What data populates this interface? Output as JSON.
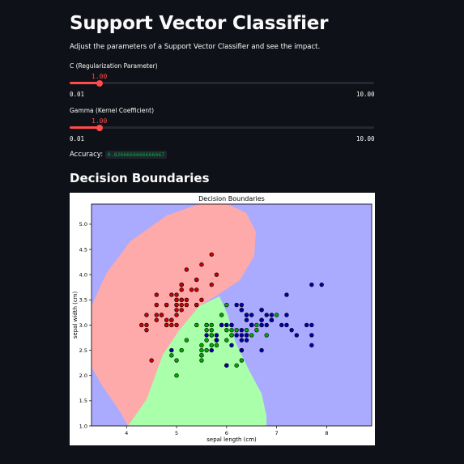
{
  "app": {
    "title": "Support Vector Classifier",
    "subtitle": "Adjust the parameters of a Support Vector Classifier and see the impact."
  },
  "sliders": [
    {
      "label": "C (Regularization Parameter)",
      "value": "1.00",
      "min": "0.01",
      "max": "10.00",
      "fraction": 0.099
    },
    {
      "label": "Gamma (Kernel Coefficient)",
      "value": "1.00",
      "min": "0.01",
      "max": "10.00",
      "fraction": 0.099
    }
  ],
  "accuracy": {
    "label": "Accuracy:",
    "value": "0.8266666666666667"
  },
  "section_heading": "Decision Boundaries",
  "colors": {
    "accent": "#ff4b4b",
    "region_setosa": "#ffaaaa",
    "region_versicolor": "#aaffaa",
    "region_virginica": "#aaaaff",
    "point_setosa": "#cc0000",
    "point_versicolor": "#00aa00",
    "point_virginica": "#0000aa"
  },
  "chart_data": {
    "type": "scatter",
    "title": "Decision Boundaries",
    "xlabel": "sepal length (cm)",
    "ylabel": "sepal width (cm)",
    "xlim": [
      3.3,
      8.9
    ],
    "ylim": [
      1.0,
      5.4
    ],
    "xticks": [
      "4",
      "5",
      "6",
      "7",
      "8"
    ],
    "yticks": [
      "1.0",
      "1.5",
      "2.0",
      "2.5",
      "3.0",
      "3.5",
      "4.0",
      "4.5",
      "5.0"
    ],
    "grid": false,
    "series": [
      {
        "class": 0,
        "points": [
          [
            5.1,
            3.5
          ],
          [
            4.9,
            3.0
          ],
          [
            4.7,
            3.2
          ],
          [
            4.6,
            3.1
          ],
          [
            5.0,
            3.6
          ],
          [
            5.4,
            3.9
          ],
          [
            4.6,
            3.4
          ],
          [
            5.0,
            3.4
          ],
          [
            4.4,
            2.9
          ],
          [
            4.9,
            3.1
          ],
          [
            5.4,
            3.7
          ],
          [
            4.8,
            3.4
          ],
          [
            4.8,
            3.0
          ],
          [
            4.3,
            3.0
          ],
          [
            5.8,
            4.0
          ],
          [
            5.7,
            4.4
          ],
          [
            5.4,
            3.9
          ],
          [
            5.1,
            3.5
          ],
          [
            5.7,
            3.8
          ],
          [
            5.1,
            3.8
          ],
          [
            5.4,
            3.4
          ],
          [
            5.1,
            3.7
          ],
          [
            4.6,
            3.6
          ],
          [
            5.1,
            3.3
          ],
          [
            4.8,
            3.4
          ],
          [
            5.0,
            3.0
          ],
          [
            5.0,
            3.4
          ],
          [
            5.2,
            3.5
          ],
          [
            5.2,
            3.4
          ],
          [
            4.7,
            3.2
          ],
          [
            4.8,
            3.1
          ],
          [
            5.4,
            3.4
          ],
          [
            5.2,
            4.1
          ],
          [
            5.5,
            4.2
          ],
          [
            4.9,
            3.1
          ],
          [
            5.0,
            3.2
          ],
          [
            5.5,
            3.5
          ],
          [
            4.9,
            3.6
          ],
          [
            4.4,
            3.0
          ],
          [
            5.1,
            3.4
          ],
          [
            5.0,
            3.5
          ],
          [
            4.5,
            2.3
          ],
          [
            4.4,
            3.2
          ],
          [
            5.0,
            3.5
          ],
          [
            5.1,
            3.8
          ],
          [
            4.8,
            3.0
          ],
          [
            5.1,
            3.8
          ],
          [
            4.6,
            3.2
          ],
          [
            5.3,
            3.7
          ],
          [
            5.0,
            3.3
          ]
        ]
      },
      {
        "class": 1,
        "points": [
          [
            7.0,
            3.2
          ],
          [
            6.4,
            3.2
          ],
          [
            6.9,
            3.1
          ],
          [
            5.5,
            2.3
          ],
          [
            6.5,
            2.8
          ],
          [
            5.7,
            2.8
          ],
          [
            6.3,
            3.3
          ],
          [
            4.9,
            2.4
          ],
          [
            6.6,
            2.9
          ],
          [
            5.2,
            2.7
          ],
          [
            5.0,
            2.0
          ],
          [
            5.9,
            3.0
          ],
          [
            6.0,
            2.2
          ],
          [
            6.1,
            2.9
          ],
          [
            5.6,
            2.9
          ],
          [
            6.7,
            3.1
          ],
          [
            5.6,
            3.0
          ],
          [
            5.8,
            2.7
          ],
          [
            6.2,
            2.2
          ],
          [
            5.6,
            2.5
          ],
          [
            5.9,
            3.2
          ],
          [
            6.1,
            2.8
          ],
          [
            6.3,
            2.5
          ],
          [
            6.1,
            2.8
          ],
          [
            6.4,
            2.9
          ],
          [
            6.6,
            3.0
          ],
          [
            6.8,
            2.8
          ],
          [
            6.7,
            3.0
          ],
          [
            6.0,
            2.9
          ],
          [
            5.7,
            2.6
          ],
          [
            5.5,
            2.4
          ],
          [
            5.5,
            2.4
          ],
          [
            5.8,
            2.7
          ],
          [
            6.0,
            2.7
          ],
          [
            5.4,
            3.0
          ],
          [
            6.0,
            3.4
          ],
          [
            6.7,
            3.1
          ],
          [
            6.3,
            2.3
          ],
          [
            5.6,
            3.0
          ],
          [
            5.5,
            2.5
          ],
          [
            5.5,
            2.6
          ],
          [
            6.1,
            3.0
          ],
          [
            5.8,
            2.6
          ],
          [
            5.0,
            2.3
          ],
          [
            5.6,
            2.7
          ],
          [
            5.7,
            3.0
          ],
          [
            5.7,
            2.9
          ],
          [
            6.2,
            2.9
          ],
          [
            5.1,
            2.5
          ],
          [
            5.7,
            2.8
          ]
        ]
      },
      {
        "class": 2,
        "points": [
          [
            6.3,
            3.3
          ],
          [
            5.8,
            2.7
          ],
          [
            7.1,
            3.0
          ],
          [
            6.3,
            2.9
          ],
          [
            6.5,
            3.0
          ],
          [
            7.6,
            3.0
          ],
          [
            4.9,
            2.5
          ],
          [
            7.3,
            2.9
          ],
          [
            6.7,
            2.5
          ],
          [
            7.2,
            3.6
          ],
          [
            6.5,
            3.2
          ],
          [
            6.4,
            2.7
          ],
          [
            6.8,
            3.0
          ],
          [
            5.7,
            2.5
          ],
          [
            5.8,
            2.8
          ],
          [
            6.4,
            3.2
          ],
          [
            6.5,
            3.0
          ],
          [
            7.7,
            3.8
          ],
          [
            7.7,
            2.6
          ],
          [
            6.0,
            2.2
          ],
          [
            6.9,
            3.2
          ],
          [
            5.6,
            2.8
          ],
          [
            7.7,
            2.8
          ],
          [
            6.3,
            2.7
          ],
          [
            6.7,
            3.3
          ],
          [
            7.2,
            3.2
          ],
          [
            6.2,
            2.8
          ],
          [
            6.1,
            3.0
          ],
          [
            6.4,
            2.8
          ],
          [
            7.2,
            3.0
          ],
          [
            7.4,
            2.8
          ],
          [
            7.9,
            3.8
          ],
          [
            6.4,
            2.8
          ],
          [
            6.3,
            2.8
          ],
          [
            6.1,
            2.6
          ],
          [
            7.7,
            3.0
          ],
          [
            6.3,
            3.4
          ],
          [
            6.4,
            3.1
          ],
          [
            6.0,
            3.0
          ],
          [
            6.9,
            3.1
          ],
          [
            6.7,
            3.1
          ],
          [
            6.9,
            3.1
          ],
          [
            5.8,
            2.7
          ],
          [
            6.8,
            3.2
          ],
          [
            6.7,
            3.3
          ],
          [
            6.7,
            3.0
          ],
          [
            6.3,
            2.5
          ],
          [
            6.5,
            3.0
          ],
          [
            6.2,
            3.4
          ],
          [
            5.9,
            3.0
          ]
        ]
      }
    ]
  }
}
